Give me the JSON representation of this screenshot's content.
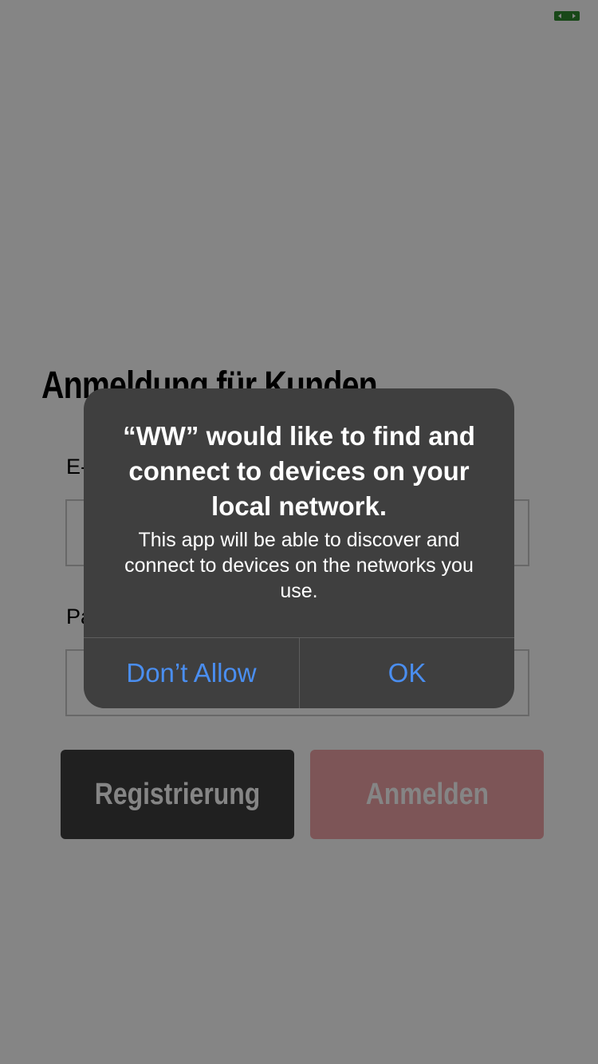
{
  "colors": {
    "overlay": "rgba(0,0,0,0.48)",
    "alert_bg": "#3f3f3f",
    "alert_action": "#4a8ef0",
    "register_button": "#3e3e3e",
    "login_button": "#f0a3a8",
    "status_icon": "#2e8b2e"
  },
  "status_bar": {
    "icon": "screen-mirroring-icon"
  },
  "login_page": {
    "title": "Anmeldung für Kunden",
    "email_label": "E-Mail",
    "password_label": "Passwort",
    "register_button": "Registrierung",
    "login_button": "Anmelden"
  },
  "alert": {
    "title": "“WW” would like to find and connect to devices on your local network.",
    "message": "This app will be able to discover and connect to devices on the networks you use.",
    "dont_allow_label": "Don’t Allow",
    "ok_label": "OK"
  }
}
